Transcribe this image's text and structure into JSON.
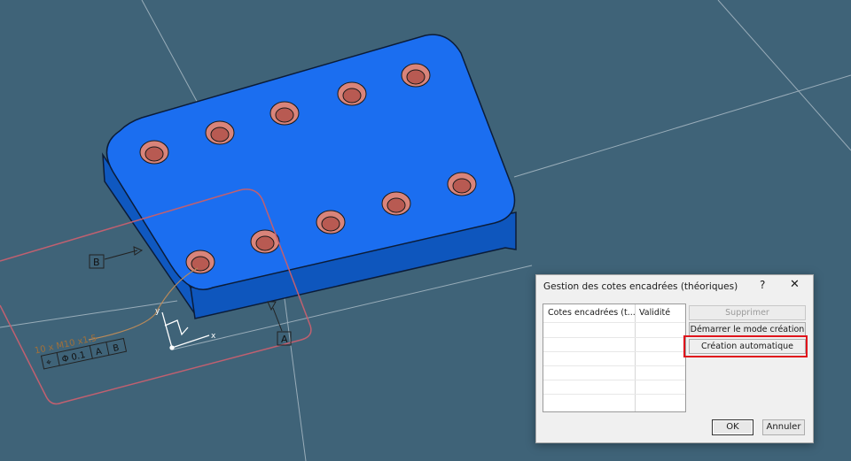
{
  "viewport": {
    "gdt_frame": {
      "tolerance_text": "10 x M10 x1.5",
      "symbol": "⌖",
      "value": "Φ 0.1",
      "ref_a": "A",
      "ref_b": "B"
    },
    "datum_b_label": "B",
    "datum_a_label": "A",
    "axis_x": "x",
    "axis_y": "y"
  },
  "dialog": {
    "title": "Gestion des cotes encadrées (théoriques)",
    "help": "?",
    "close": "✕",
    "list": {
      "col1": "Cotes encadrées (t...",
      "col2": "Validité"
    },
    "buttons": {
      "delete": "Supprimer",
      "start": "Démarrer le mode création",
      "auto": "Création automatique",
      "ok": "OK",
      "cancel": "Annuler"
    }
  }
}
